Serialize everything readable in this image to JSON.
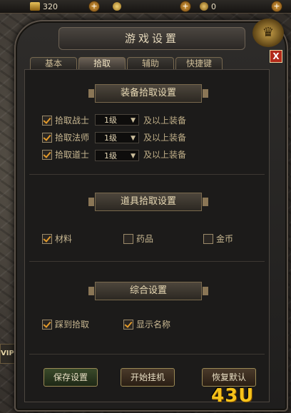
{
  "topbar": {
    "gold": "320",
    "coupon": "0",
    "plus": "+"
  },
  "dialog": {
    "title": "游戏设置",
    "close": "X",
    "emblem": "♛"
  },
  "tabs": [
    "基本",
    "拾取",
    "辅助",
    "快捷键"
  ],
  "equipment": {
    "title": "装备拾取设置",
    "rows": [
      {
        "label": "拾取战士",
        "checked": true,
        "level": "1级",
        "suffix": "及以上装备"
      },
      {
        "label": "拾取法师",
        "checked": true,
        "level": "1级",
        "suffix": "及以上装备"
      },
      {
        "label": "拾取道士",
        "checked": true,
        "level": "1级",
        "suffix": "及以上装备"
      }
    ]
  },
  "items": {
    "title": "道具拾取设置",
    "options": [
      {
        "label": "材料",
        "checked": true
      },
      {
        "label": "药品",
        "checked": false
      },
      {
        "label": "金币",
        "checked": false
      }
    ]
  },
  "general": {
    "title": "综合设置",
    "options": [
      {
        "label": "踩到拾取",
        "checked": true
      },
      {
        "label": "显示名称",
        "checked": true
      }
    ]
  },
  "buttons": {
    "save": "保存设置",
    "start": "开始挂机",
    "restore": "恢复默认"
  },
  "side": {
    "vip": "VIP"
  },
  "logo": "43U"
}
